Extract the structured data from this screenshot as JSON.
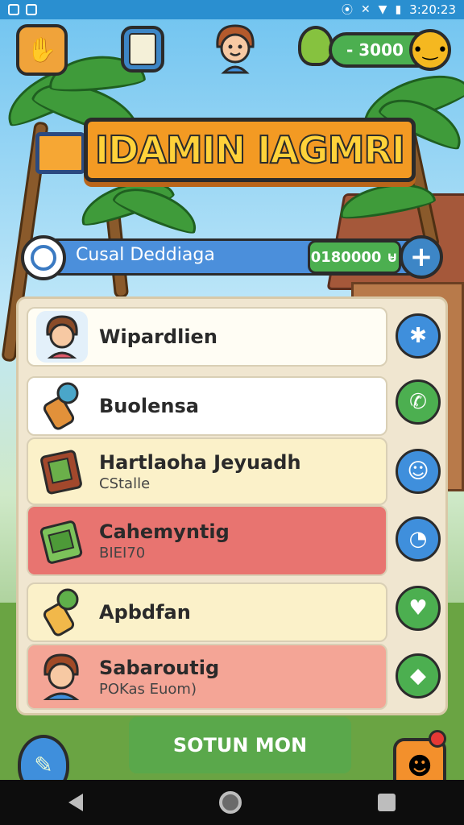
{
  "status_bar": {
    "time": "3:20:23"
  },
  "top_bar": {
    "coins_value": "- 3000"
  },
  "title": "IDAMIN IAGMRI",
  "name_bar": {
    "label": "Cusal Deddiaga",
    "value": "0180000 ⊌"
  },
  "list": [
    {
      "name": "Wipardlien",
      "sub": "",
      "icon": "person-icon"
    },
    {
      "name": "Buolensa",
      "sub": "",
      "icon": "torch-icon"
    },
    {
      "name": "Hartlaoha Jeyuadh",
      "sub": "CStalle",
      "icon": "book-icon"
    },
    {
      "name": "Cahemyntig",
      "sub": "BIEI70",
      "icon": "cash-icon"
    },
    {
      "name": "Apbdfan",
      "sub": "",
      "icon": "torch-icon"
    },
    {
      "name": "Sabaroutig",
      "sub": "POKas Euom)",
      "icon": "person-icon"
    }
  ],
  "side_buttons": [
    "star-icon",
    "phone-icon",
    "smile-icon",
    "chat-icon",
    "heart-icon",
    "diamond-icon"
  ],
  "bottom": {
    "action_label": "SOTUN MON"
  },
  "colors": {
    "accent_blue": "#3f8fdc",
    "accent_green": "#4caf50",
    "accent_orange": "#f39a23"
  }
}
